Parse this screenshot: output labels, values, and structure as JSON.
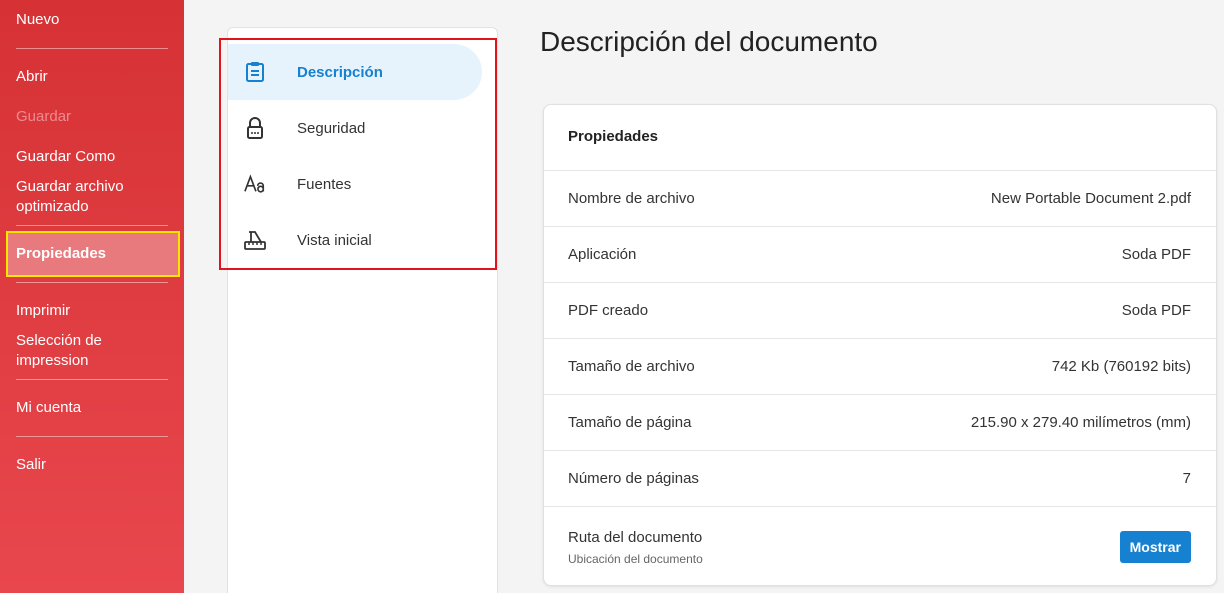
{
  "menu": {
    "nuevo": "Nuevo",
    "abrir": "Abrir",
    "guardar": "Guardar",
    "guardar_como": "Guardar Como",
    "guardar_optimizado_1": "Guardar archivo",
    "guardar_optimizado_2": "optimizado",
    "propiedades": "Propiedades",
    "imprimir": "Imprimir",
    "seleccion_1": "Selección de",
    "seleccion_2": "impression",
    "mi_cuenta": "Mi cuenta",
    "salir": "Salir"
  },
  "nav": {
    "items": [
      {
        "label": "Descripción",
        "icon": "clipboard-icon"
      },
      {
        "label": "Seguridad",
        "icon": "lock-icon"
      },
      {
        "label": "Fuentes",
        "icon": "font-icon"
      },
      {
        "label": "Vista inicial",
        "icon": "ruler-icon"
      }
    ]
  },
  "main": {
    "title": "Descripción del documento",
    "card_title": "Propiedades",
    "rows": [
      {
        "label": "Nombre de archivo",
        "value": "New Portable Document 2.pdf"
      },
      {
        "label": "Aplicación",
        "value": "Soda PDF"
      },
      {
        "label": "PDF creado",
        "value": "Soda PDF"
      },
      {
        "label": "Tamaño de archivo",
        "value": "742 Kb (760192 bits)"
      },
      {
        "label": "Tamaño de página",
        "value": "215.90 x 279.40 milímetros (mm)"
      },
      {
        "label": "Número de páginas",
        "value": "7"
      }
    ],
    "path": {
      "label": "Ruta del documento",
      "sublabel": "Ubicación del documento",
      "button": "Mostrar"
    }
  },
  "colors": {
    "menu_red": "#d63235",
    "accent_blue": "#1681d0",
    "highlight_yellow": "#ffe600",
    "highlight_red": "#e1141b"
  }
}
